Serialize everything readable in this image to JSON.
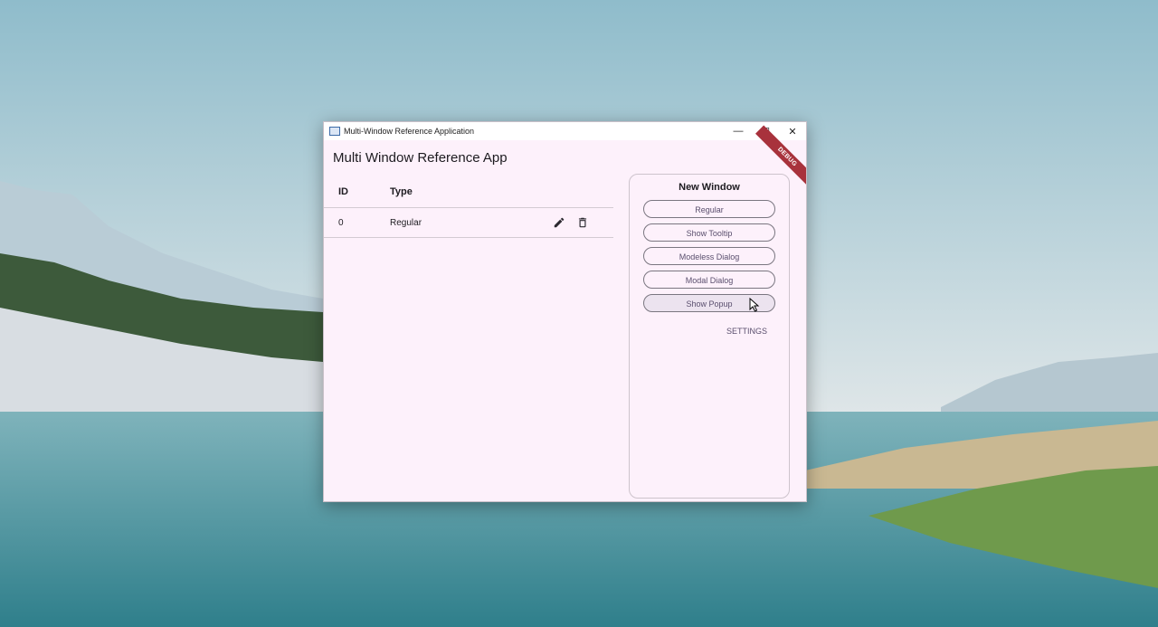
{
  "window": {
    "title": "Multi-Window Reference Application",
    "minimize_glyph": "—",
    "maximize_glyph": "☐",
    "close_glyph": "✕"
  },
  "app": {
    "title": "Multi Window Reference App",
    "debug_banner": "DEBUG"
  },
  "table": {
    "headers": [
      "ID",
      "Type"
    ],
    "rows": [
      {
        "id": "0",
        "type": "Regular"
      }
    ]
  },
  "panel": {
    "title": "New Window",
    "buttons": [
      "Regular",
      "Show Tooltip",
      "Modeless Dialog",
      "Modal Dialog",
      "Show Popup"
    ],
    "settings_label": "SETTINGS"
  },
  "colors": {
    "window_bg": "#fdf1fb",
    "accent_text": "#5a4f6e",
    "debug_ribbon": "#a8323c"
  }
}
